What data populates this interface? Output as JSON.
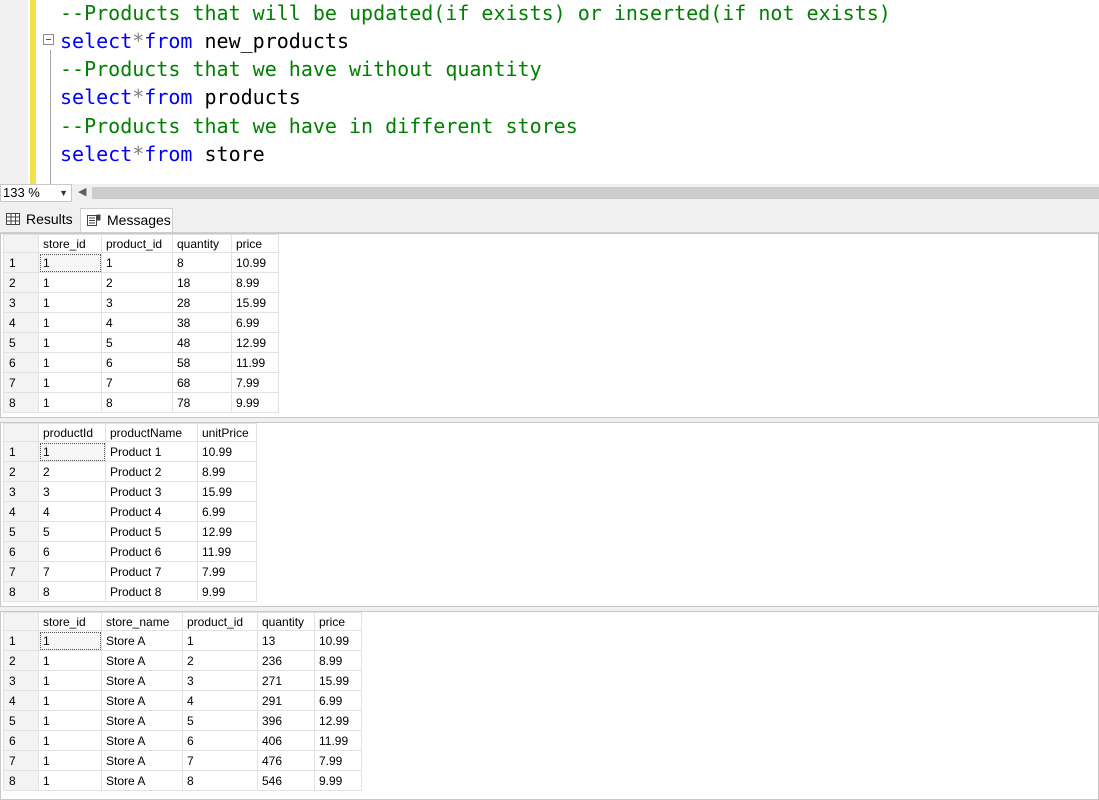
{
  "editor": {
    "lines": [
      {
        "type": "comment",
        "text": "--Products that will be updated(if exists) or inserted(if not exists)"
      },
      {
        "type": "select",
        "kw1": "select",
        "op": "*",
        "kw2": "from",
        "table": "new_products"
      },
      {
        "type": "comment",
        "text": "--Products that we have without quantity"
      },
      {
        "type": "select",
        "kw1": "select",
        "op": "*",
        "kw2": "from",
        "table": "products"
      },
      {
        "type": "comment",
        "text": "--Products that we have in different stores"
      },
      {
        "type": "select",
        "kw1": "select",
        "op": "*",
        "kw2": "from",
        "table": "store"
      }
    ]
  },
  "zoom": {
    "value": "133 %"
  },
  "tabs": {
    "results": "Results",
    "messages": "Messages"
  },
  "grids": [
    {
      "columns": [
        "store_id",
        "product_id",
        "quantity",
        "price"
      ],
      "rows": [
        [
          "1",
          "1",
          "8",
          "10.99"
        ],
        [
          "1",
          "2",
          "18",
          "8.99"
        ],
        [
          "1",
          "3",
          "28",
          "15.99"
        ],
        [
          "1",
          "4",
          "38",
          "6.99"
        ],
        [
          "1",
          "5",
          "48",
          "12.99"
        ],
        [
          "1",
          "6",
          "58",
          "11.99"
        ],
        [
          "1",
          "7",
          "68",
          "7.99"
        ],
        [
          "1",
          "8",
          "78",
          "9.99"
        ]
      ]
    },
    {
      "columns": [
        "productId",
        "productName",
        "unitPrice"
      ],
      "rows": [
        [
          "1",
          "Product 1",
          "10.99"
        ],
        [
          "2",
          "Product 2",
          "8.99"
        ],
        [
          "3",
          "Product 3",
          "15.99"
        ],
        [
          "4",
          "Product 4",
          "6.99"
        ],
        [
          "5",
          "Product 5",
          "12.99"
        ],
        [
          "6",
          "Product 6",
          "11.99"
        ],
        [
          "7",
          "Product 7",
          "7.99"
        ],
        [
          "8",
          "Product 8",
          "9.99"
        ]
      ]
    },
    {
      "columns": [
        "store_id",
        "store_name",
        "product_id",
        "quantity",
        "price"
      ],
      "rows": [
        [
          "1",
          "Store A",
          "1",
          "13",
          "10.99"
        ],
        [
          "1",
          "Store A",
          "2",
          "236",
          "8.99"
        ],
        [
          "1",
          "Store A",
          "3",
          "271",
          "15.99"
        ],
        [
          "1",
          "Store A",
          "4",
          "291",
          "6.99"
        ],
        [
          "1",
          "Store A",
          "5",
          "396",
          "12.99"
        ],
        [
          "1",
          "Store A",
          "6",
          "406",
          "11.99"
        ],
        [
          "1",
          "Store A",
          "7",
          "476",
          "7.99"
        ],
        [
          "1",
          "Store A",
          "8",
          "546",
          "9.99"
        ]
      ]
    }
  ],
  "colors": {
    "keyword": "#0000ff",
    "comment": "#008000",
    "operator": "#808080",
    "change_bar": "#f2e24a"
  },
  "icons": {
    "results_tab": "grid-icon",
    "messages_tab": "messages-icon",
    "collapse": "collapse-minus-icon"
  }
}
